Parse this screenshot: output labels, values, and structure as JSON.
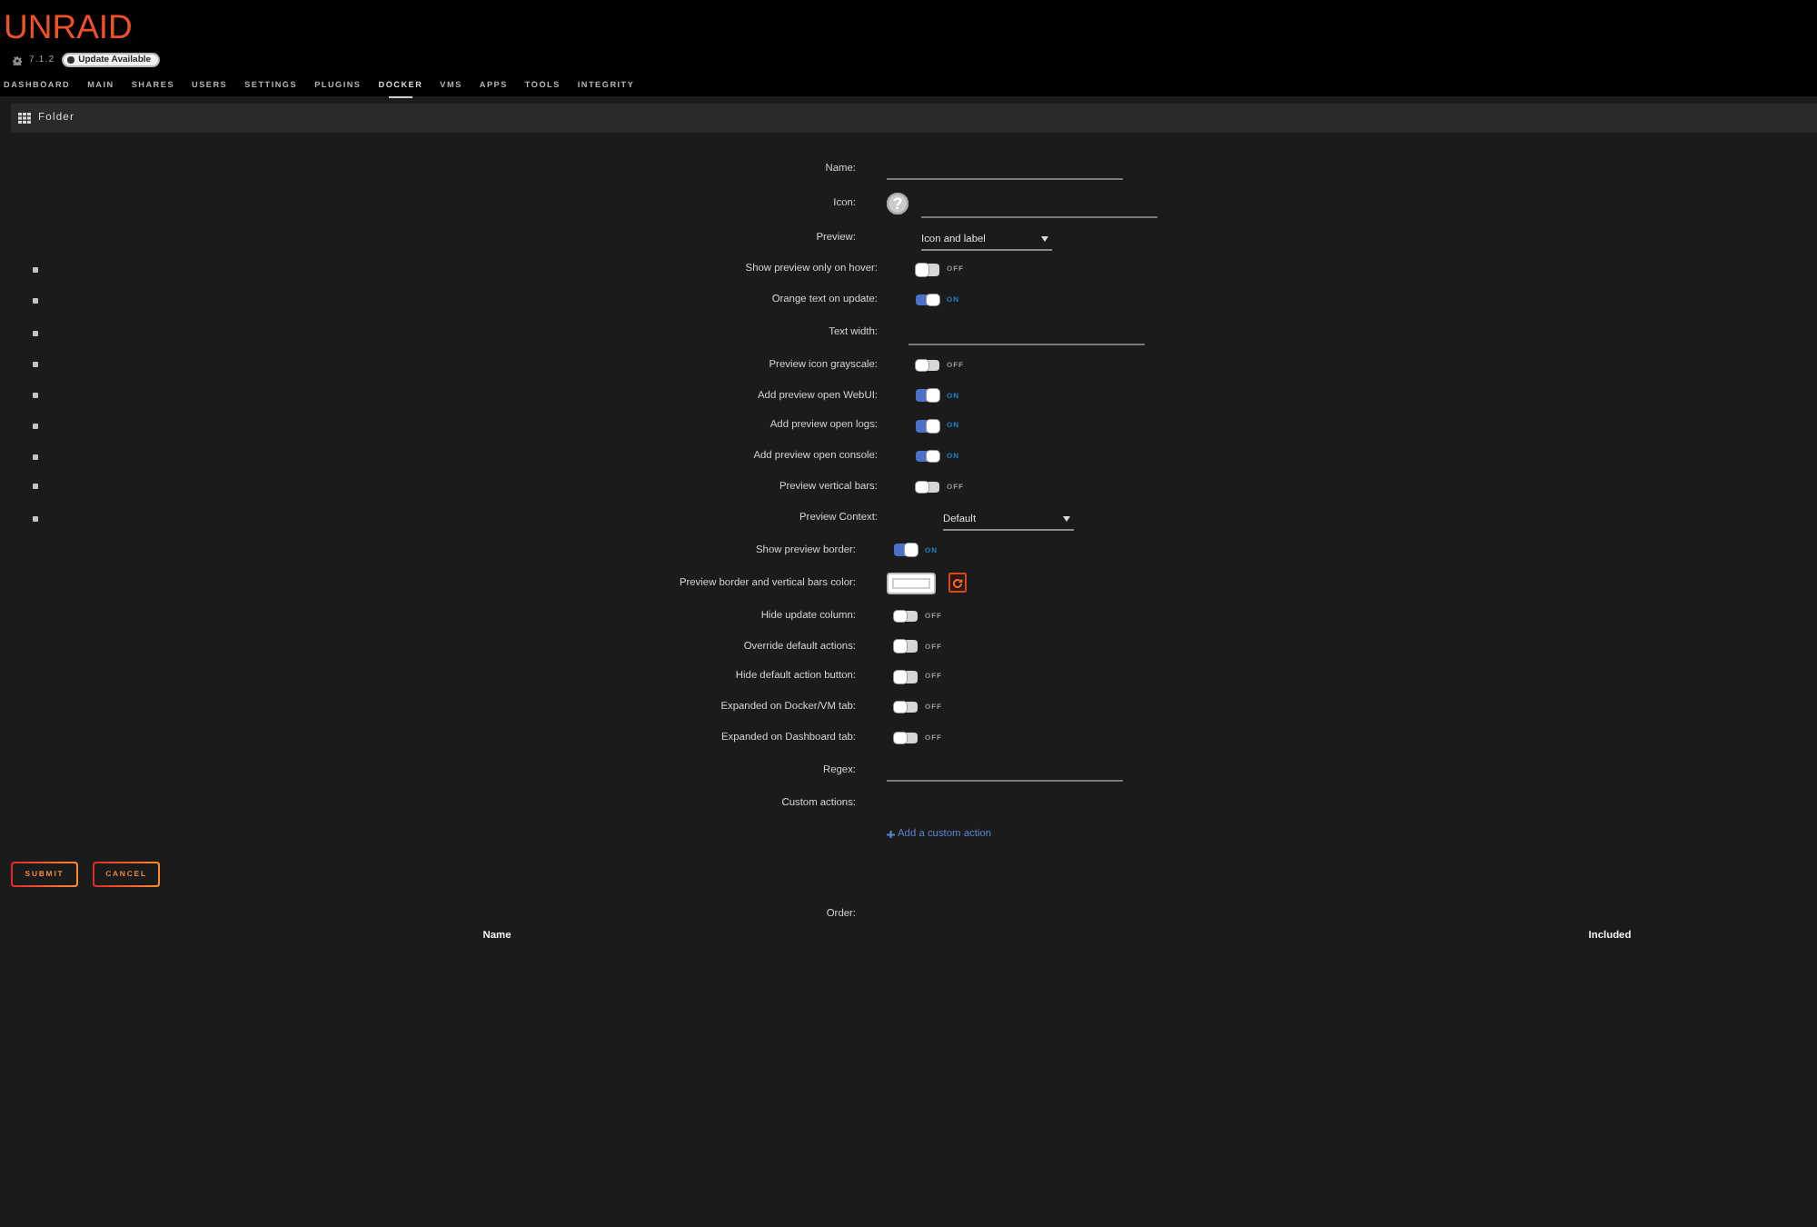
{
  "header": {
    "logo": "UNRAID",
    "version": "7.1.2",
    "update_badge": "Update Available"
  },
  "nav": [
    {
      "label": "DASHBOARD",
      "selected": false
    },
    {
      "label": "MAIN",
      "selected": false
    },
    {
      "label": "SHARES",
      "selected": false
    },
    {
      "label": "USERS",
      "selected": false
    },
    {
      "label": "SETTINGS",
      "selected": false
    },
    {
      "label": "PLUGINS",
      "selected": false
    },
    {
      "label": "DOCKER",
      "selected": true
    },
    {
      "label": "VMS",
      "selected": false
    },
    {
      "label": "APPS",
      "selected": false
    },
    {
      "label": "TOOLS",
      "selected": false
    },
    {
      "label": "INTEGRITY",
      "selected": false
    }
  ],
  "panel": {
    "title": "Folder"
  },
  "form": {
    "rows": [
      {
        "kind": "text",
        "label": "Name:",
        "bullet": false
      },
      {
        "kind": "icon",
        "label": "Icon:",
        "bullet": false,
        "glyph": "?"
      },
      {
        "kind": "select",
        "label": "Preview:",
        "bullet": false,
        "value": "Icon and label"
      },
      {
        "kind": "toggle",
        "label": "Show preview only on hover:",
        "bullet": true,
        "on": false,
        "state_text": "OFF"
      },
      {
        "kind": "toggle",
        "label": "Orange text on update:",
        "bullet": true,
        "on": true,
        "state_text": "ON"
      },
      {
        "kind": "text",
        "label": "Text width:",
        "bullet": true
      },
      {
        "kind": "toggle",
        "label": "Preview icon grayscale:",
        "bullet": true,
        "on": false,
        "state_text": "OFF"
      },
      {
        "kind": "toggle",
        "label": "Add preview open WebUI:",
        "bullet": true,
        "on": true,
        "state_text": "ON"
      },
      {
        "kind": "toggle",
        "label": "Add preview open logs:",
        "bullet": true,
        "on": true,
        "state_text": "ON"
      },
      {
        "kind": "toggle",
        "label": "Add preview open console:",
        "bullet": true,
        "on": true,
        "state_text": "ON"
      },
      {
        "kind": "toggle",
        "label": "Preview vertical bars:",
        "bullet": true,
        "on": false,
        "state_text": "OFF"
      },
      {
        "kind": "select",
        "label": "Preview Context:",
        "bullet": true,
        "value": "Default"
      },
      {
        "kind": "toggle",
        "label": "Show preview border:",
        "bullet": false,
        "on": true,
        "state_text": "ON"
      },
      {
        "kind": "color",
        "label": "Preview border and vertical bars color:",
        "bullet": false,
        "color": "#ffffff"
      },
      {
        "kind": "toggle",
        "label": "Hide update column:",
        "bullet": false,
        "on": false,
        "state_text": "OFF"
      },
      {
        "kind": "toggle",
        "label": "Override default actions:",
        "bullet": false,
        "on": false,
        "state_text": "OFF"
      },
      {
        "kind": "toggle",
        "label": "Hide default action button:",
        "bullet": false,
        "on": false,
        "state_text": "OFF"
      },
      {
        "kind": "toggle",
        "label": "Expanded on Docker/VM tab:",
        "bullet": false,
        "on": false,
        "state_text": "OFF"
      },
      {
        "kind": "toggle",
        "label": "Expanded on Dashboard tab:",
        "bullet": false,
        "on": false,
        "state_text": "OFF"
      },
      {
        "kind": "text",
        "label": "Regex:",
        "bullet": false
      },
      {
        "kind": "label",
        "label": "Custom actions:",
        "bullet": false
      }
    ],
    "add_action_link": "Add a custom action",
    "buttons": [
      "SUBMIT",
      "CANCEL"
    ]
  },
  "order": {
    "label": "Order:",
    "table": {
      "columns": [
        "Name",
        "Included"
      ]
    }
  }
}
